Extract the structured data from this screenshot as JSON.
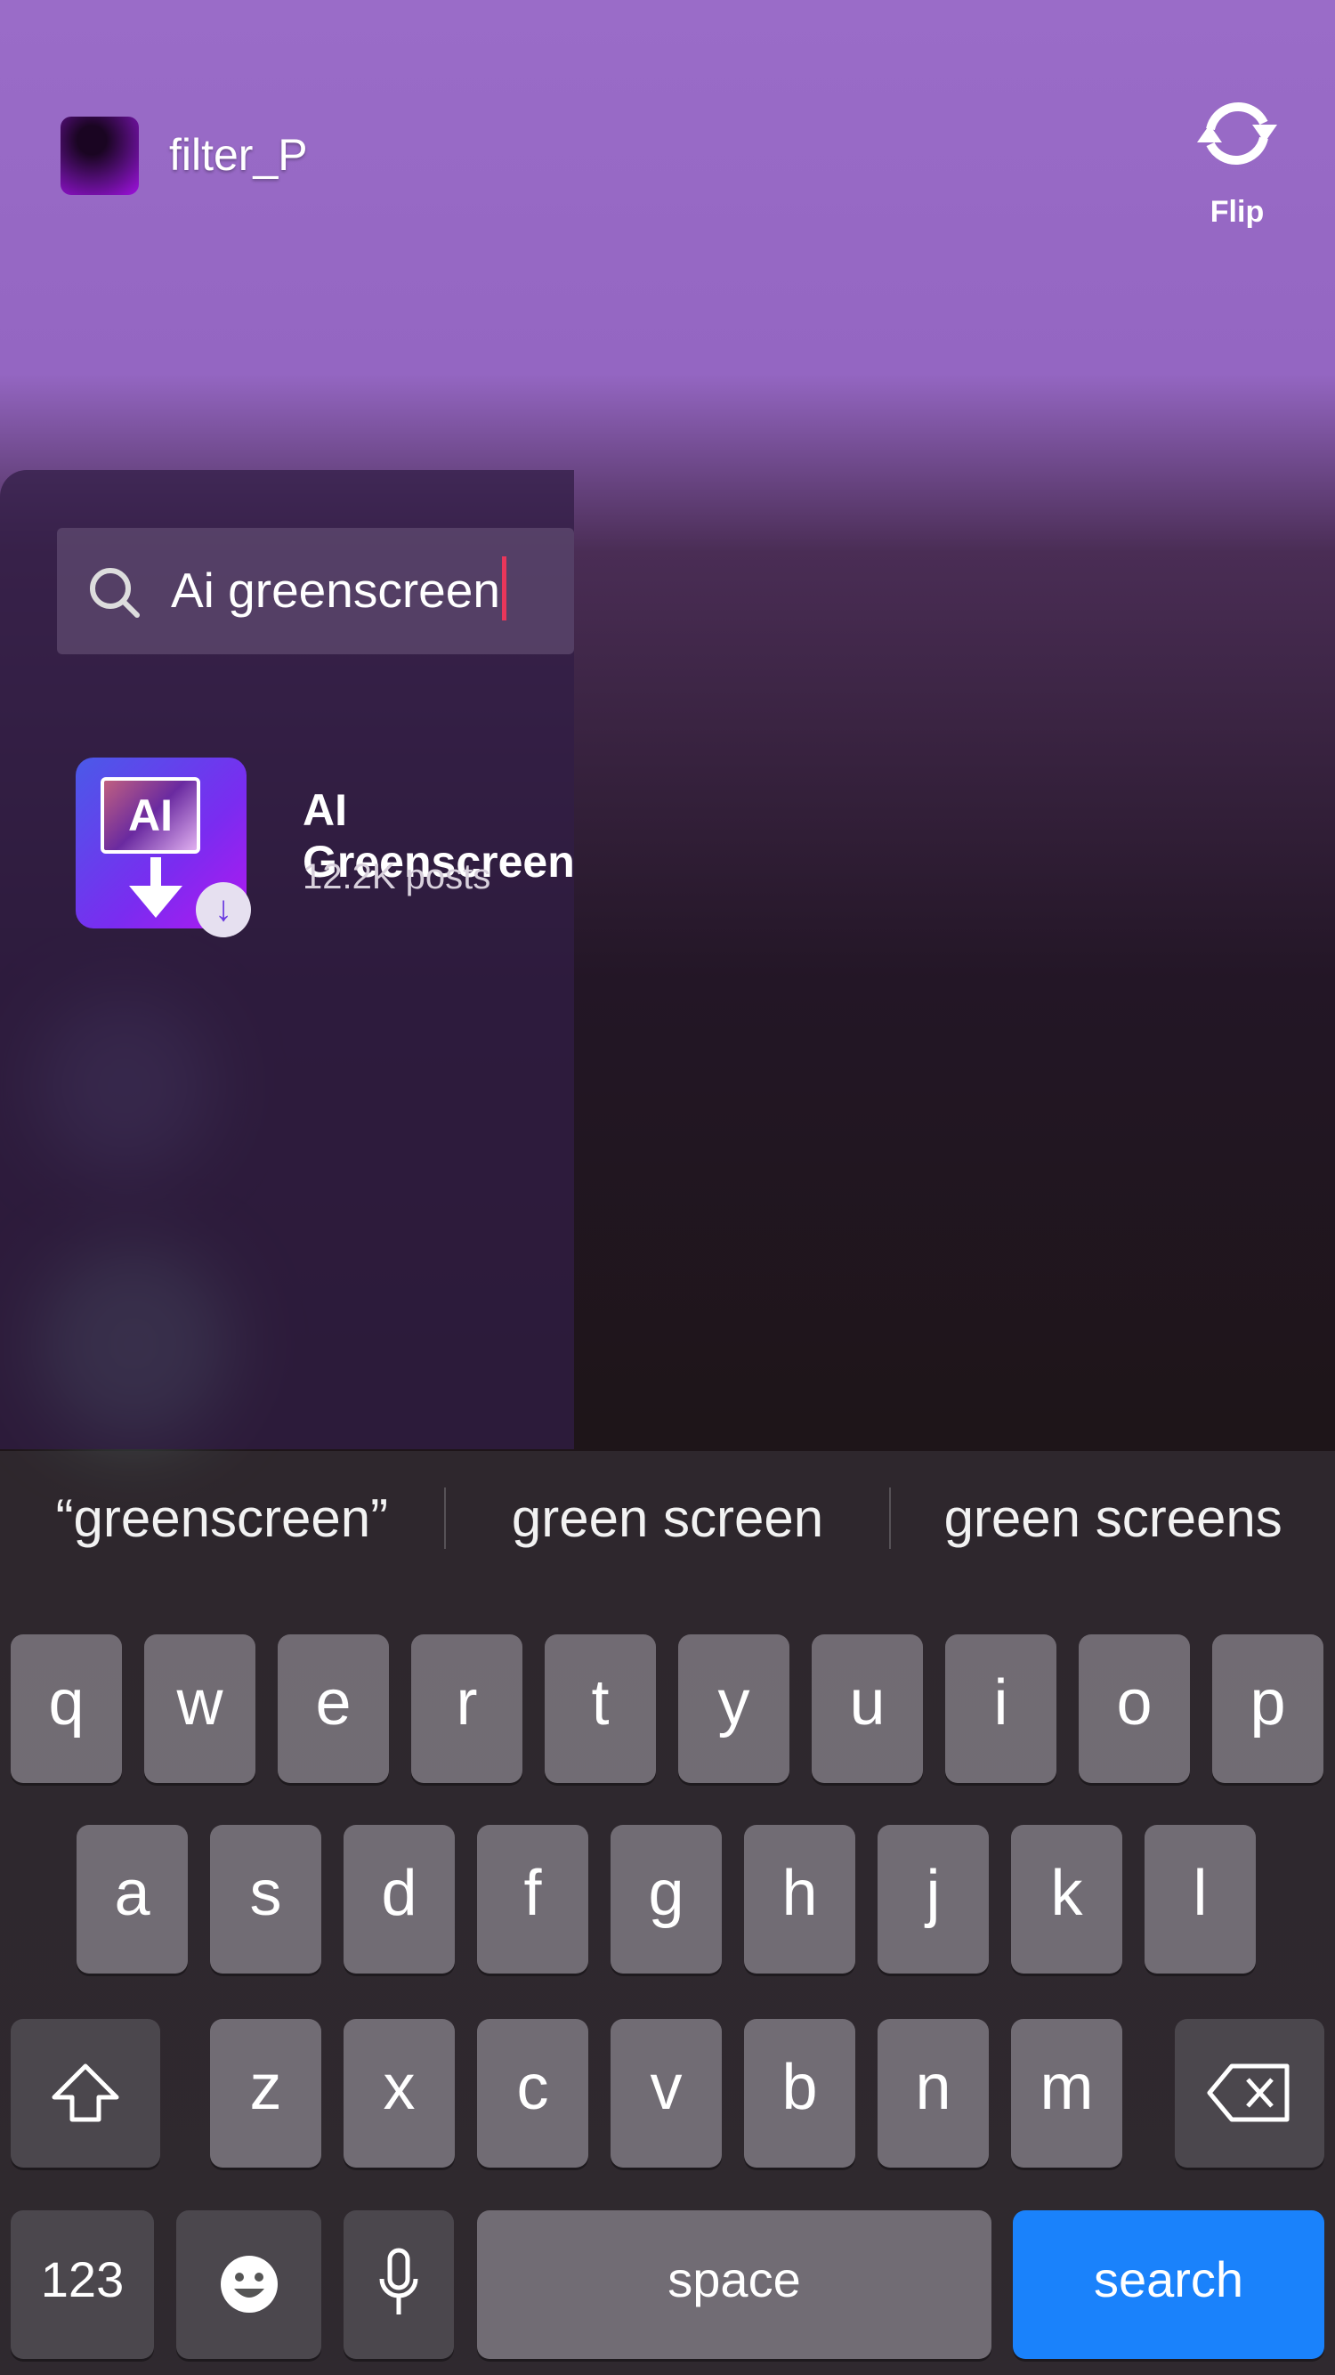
{
  "header": {
    "filter_name": "filter_P",
    "flip_label": "Flip",
    "icon": "flip-camera-icon"
  },
  "search": {
    "value": "Ai greenscreen",
    "icon": "search-icon"
  },
  "results": [
    {
      "title": "AI Greenscreen",
      "subtitle": "12.2K posts",
      "icon_text": "AI"
    }
  ],
  "keyboard": {
    "suggestions": [
      "“greenscreen”",
      "green screen",
      "green screens"
    ],
    "row1": [
      "q",
      "w",
      "e",
      "r",
      "t",
      "y",
      "u",
      "i",
      "o",
      "p"
    ],
    "row2": [
      "a",
      "s",
      "d",
      "f",
      "g",
      "h",
      "j",
      "k",
      "l"
    ],
    "row3": [
      "z",
      "x",
      "c",
      "v",
      "b",
      "n",
      "m"
    ],
    "numbers_label": "123",
    "space_label": "space",
    "search_label": "search",
    "accent_color": "#1a82fb"
  }
}
